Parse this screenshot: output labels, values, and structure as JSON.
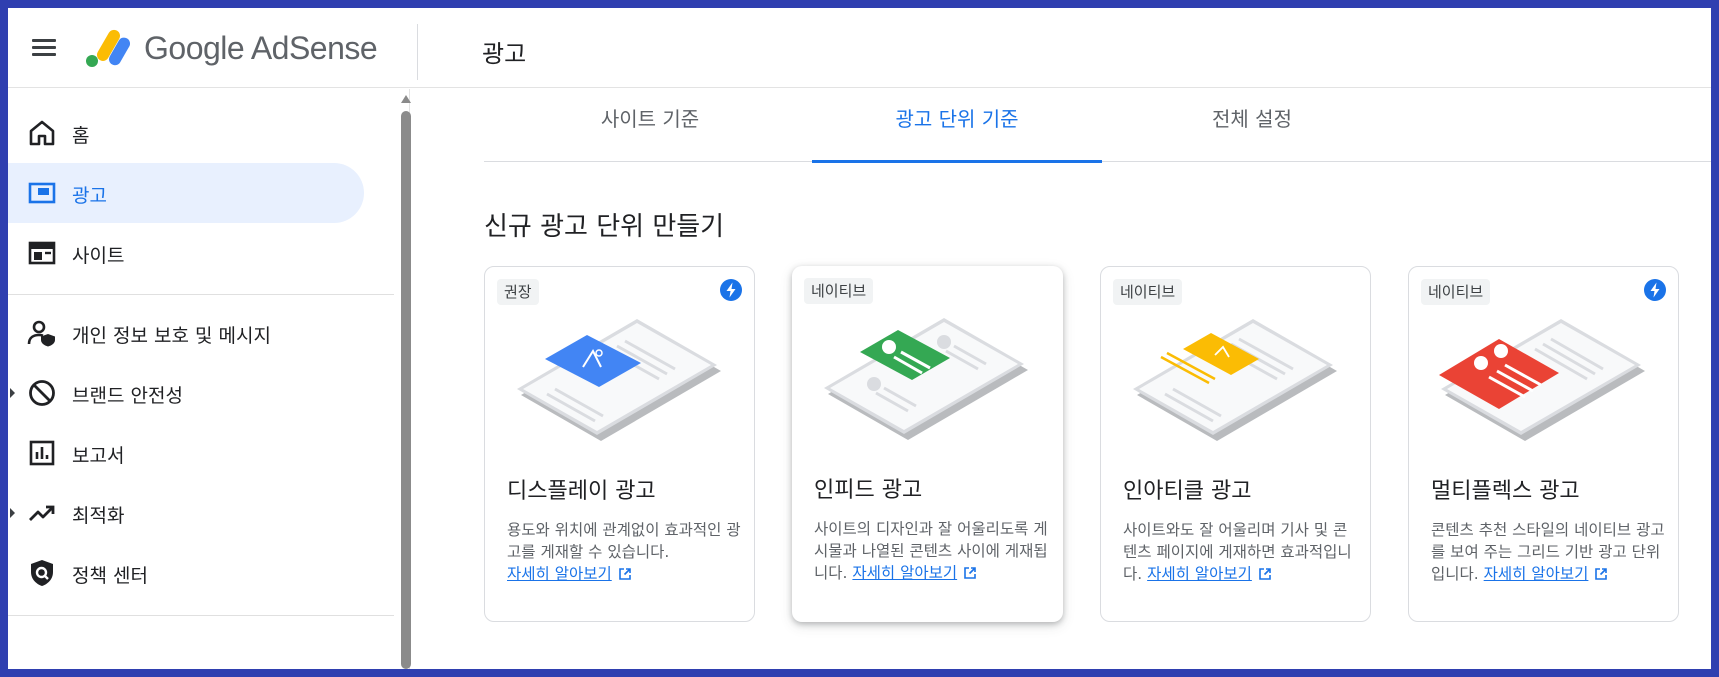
{
  "header": {
    "brand": "Google AdSense",
    "page_title": "광고"
  },
  "sidebar": {
    "items": [
      {
        "label": "홈",
        "icon": "home-icon"
      },
      {
        "label": "광고",
        "icon": "ads-icon",
        "active": true
      },
      {
        "label": "사이트",
        "icon": "sites-icon"
      },
      {
        "label": "개인 정보 보호 및 메시지",
        "icon": "privacy-icon"
      },
      {
        "label": "브랜드 안전성",
        "icon": "block-icon",
        "expandable": true
      },
      {
        "label": "보고서",
        "icon": "reports-icon"
      },
      {
        "label": "최적화",
        "icon": "trending-icon",
        "expandable": true
      },
      {
        "label": "정책 센터",
        "icon": "policy-icon"
      }
    ]
  },
  "tabs": [
    {
      "label": "사이트 기준"
    },
    {
      "label": "광고 단위 기준",
      "active": true
    },
    {
      "label": "전체 설정"
    }
  ],
  "main": {
    "section_title": "신규 광고 단위 만들기",
    "cards": [
      {
        "badge": "권장",
        "bolt": true,
        "title": "디스플레이 광고",
        "desc": "용도와 위치에 관계없이 효과적인 광고를 게재할 수 있습니다.",
        "link": "자세히 알아보기",
        "color": "#4285f4"
      },
      {
        "badge": "네이티브",
        "bolt": false,
        "title": "인피드 광고",
        "desc": "사이트의 디자인과 잘 어울리도록 게시물과 나열된 콘텐츠 사이에 게재됩니다.",
        "link": "자세히 알아보기",
        "color": "#34a853"
      },
      {
        "badge": "네이티브",
        "bolt": false,
        "title": "인아티클 광고",
        "desc": "사이트와도 잘 어울리며 기사 및 콘텐츠 페이지에 게재하면 효과적입니다.",
        "link": "자세히 알아보기",
        "color": "#fbbc04"
      },
      {
        "badge": "네이티브",
        "bolt": true,
        "title": "멀티플렉스 광고",
        "desc": "콘텐츠 추천 스타일의 네이티브 광고를 보여 주는 그리드 기반 광고 단위입니다.",
        "link": "자세히 알아보기",
        "color": "#ea4335"
      }
    ]
  },
  "colors": {
    "accent": "#1a73e8",
    "active_bg": "#e8f0fe",
    "frame": "#2f3fb0"
  }
}
